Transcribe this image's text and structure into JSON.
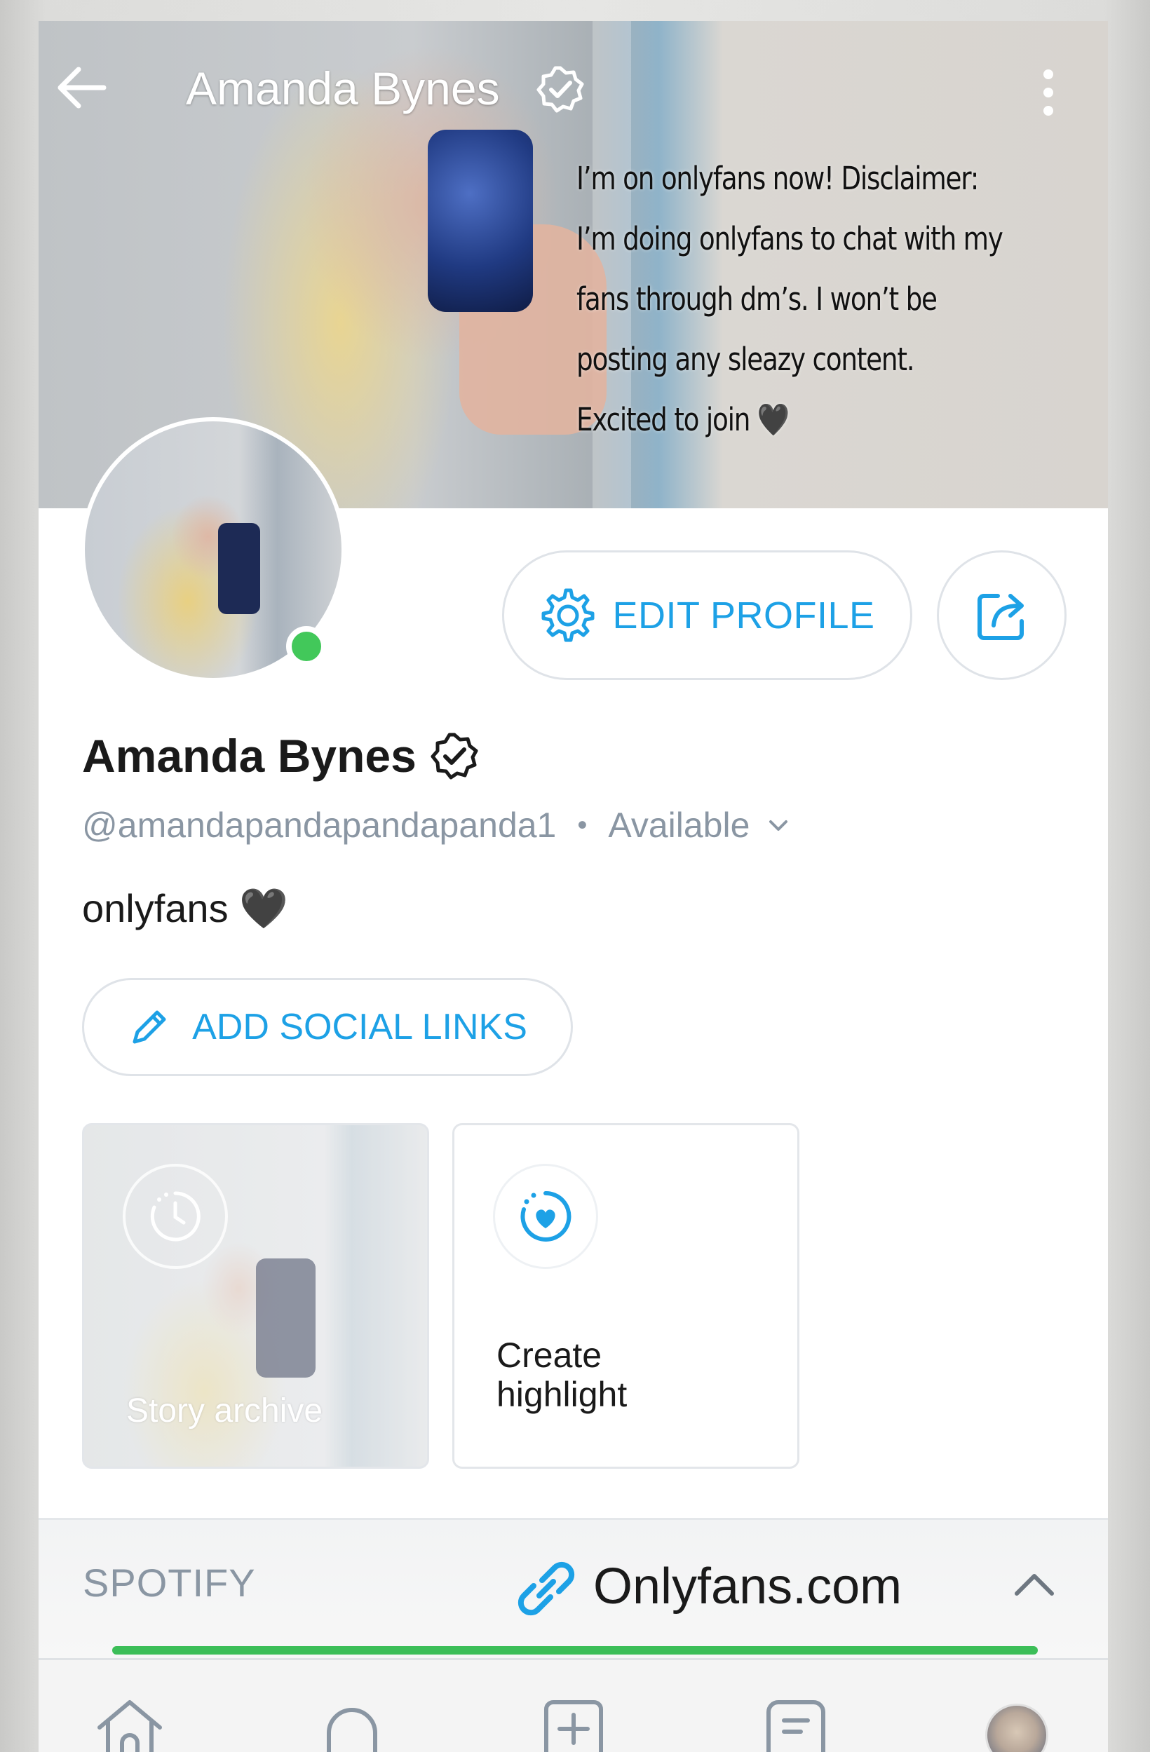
{
  "cover": {
    "title": "Amanda Bynes",
    "caption": "I’m on onlyfans now! Disclaimer:\nI’m doing onlyfans to chat with my\nfans through dm’s. I won’t be\nposting any sleazy content.\nExcited to join 🖤"
  },
  "profile": {
    "name": "Amanda Bynes",
    "handle": "@amandapandapandapanda1",
    "status": "Available",
    "bio": "onlyfans 🖤"
  },
  "buttons": {
    "edit_profile": "EDIT PROFILE",
    "add_social_links": "ADD SOCIAL LINKS"
  },
  "highlights": {
    "story_archive": "Story archive",
    "create_highlight": "Create highlight"
  },
  "links": {
    "section_label": "SPOTIFY",
    "url_text": "Onlyfans.com"
  },
  "colors": {
    "accent": "#1da1e6",
    "online": "#42c85a",
    "link_bar_progress": "#3cbe58",
    "muted_text": "#8a96a3"
  },
  "icons": {
    "back": "arrow-left",
    "verified": "verified-badge",
    "more": "vertical-dots",
    "edit": "gear",
    "share": "share-arrow",
    "pencil": "pencil",
    "archive": "clock-history",
    "highlight": "heart-dashed-circle",
    "link": "chain-link",
    "collapse": "chevron-up",
    "nav": [
      "home",
      "notifications",
      "add-post",
      "messages",
      "profile-avatar"
    ]
  }
}
